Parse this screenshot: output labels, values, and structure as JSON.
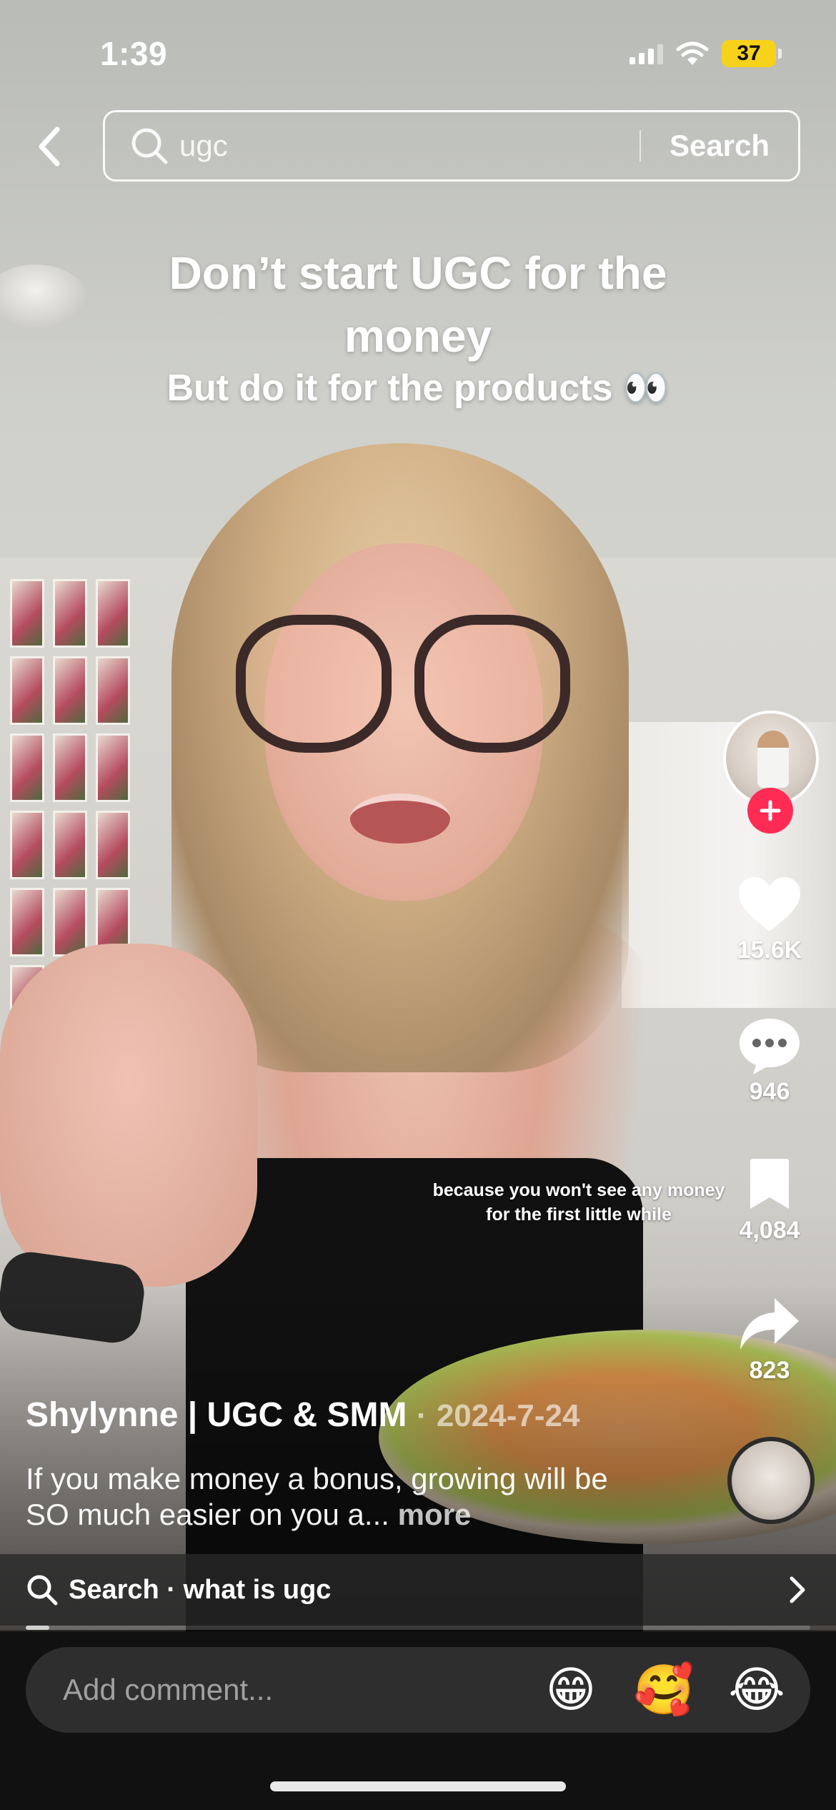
{
  "status_bar": {
    "time": "1:39",
    "battery_level": "37",
    "battery_color": "#f7d21a",
    "icons": [
      "signal-icon",
      "wifi-icon",
      "battery-icon"
    ]
  },
  "header": {
    "back_icon": "chevron-left-icon",
    "search_icon": "search-icon",
    "search_query": "ugc",
    "search_button_label": "Search"
  },
  "video": {
    "caption_title": "Don’t start UGC for the money",
    "caption_subtitle": "But do it for the products 👀",
    "caption_overlay": "because you won't see any money for the first little while"
  },
  "actions": {
    "follow_icon": "plus-icon",
    "follow_color": "#fe2c55",
    "like_icon": "heart-icon",
    "likes": "15.6K",
    "comment_icon": "comment-bubble-icon",
    "comments": "946",
    "bookmark_icon": "bookmark-icon",
    "saves": "4,084",
    "share_icon": "share-arrow-icon",
    "shares": "823"
  },
  "post": {
    "author": "Shylynne | UGC & SMM",
    "separator": "·",
    "date": "2024-7-24",
    "description": "If you make money a bonus, growing will be SO much easier on you a...",
    "more_label": "more"
  },
  "search_suggestion": {
    "label": "Search · what is ugc",
    "icon": "search-icon",
    "chevron_icon": "chevron-right-icon"
  },
  "playback": {
    "progress": 0.03
  },
  "comment_bar": {
    "placeholder": "Add comment...",
    "emojis": [
      "😁",
      "🥰",
      "😂"
    ]
  }
}
